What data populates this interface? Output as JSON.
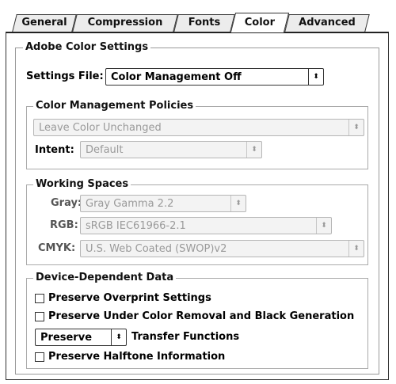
{
  "tabs": [
    {
      "label": "General"
    },
    {
      "label": "Compression"
    },
    {
      "label": "Fonts"
    },
    {
      "label": "Color"
    },
    {
      "label": "Advanced"
    }
  ],
  "active_tab": "Color",
  "adobe_color_settings": {
    "group_label": "Adobe Color Settings",
    "settings_file_label": "Settings File:",
    "settings_file_value": "Color Management Off"
  },
  "color_management_policies": {
    "group_label": "Color Management Policies",
    "policy_value": "Leave Color Unchanged",
    "intent_label": "Intent:",
    "intent_value": "Default"
  },
  "working_spaces": {
    "group_label": "Working Spaces",
    "gray_label": "Gray:",
    "gray_value": "Gray Gamma 2.2",
    "rgb_label": "RGB:",
    "rgb_value": "sRGB IEC61966-2.1",
    "cmyk_label": "CMYK:",
    "cmyk_value": "U.S. Web Coated (SWOP)v2"
  },
  "device_dependent_data": {
    "group_label": "Device-Dependent Data",
    "preserve_overprint_label": "Preserve Overprint Settings",
    "preserve_ucr_label": "Preserve Under Color Removal and Black Generation",
    "transfer_select_value": "Preserve",
    "transfer_label": "Transfer Functions",
    "preserve_halftone_label": "Preserve Halftone Information"
  }
}
